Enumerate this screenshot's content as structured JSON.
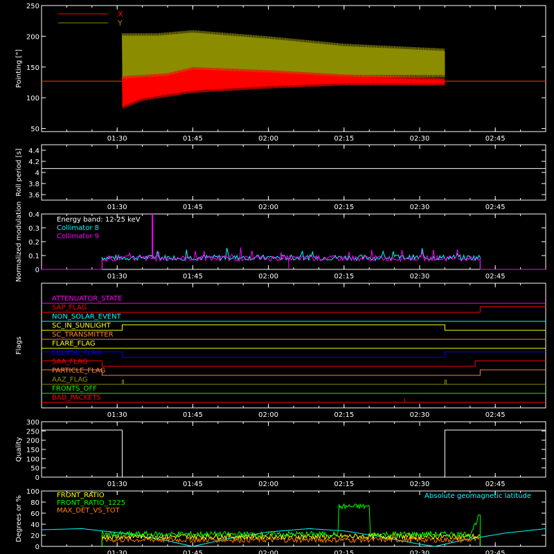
{
  "chart_data": [
    {
      "type": "line",
      "ylabel": "Pointing [\"]",
      "ylim": [
        45,
        250
      ],
      "yticks": [
        50,
        100,
        150,
        200,
        250
      ],
      "xlim": [
        "01:15",
        "02:55"
      ],
      "xticks": [
        "01:30",
        "01:45",
        "02:00",
        "02:15",
        "02:30",
        "02:45"
      ],
      "legend": [
        "X",
        "Y"
      ],
      "legend_colors": [
        "#ff0000",
        "#8c8c00"
      ],
      "series": [
        {
          "name": "Y",
          "color": "#8c8c00",
          "baseline": 127,
          "active_start": "01:31",
          "active_end": "02:35",
          "band_min": [
            [
              "01:31",
              100
            ],
            [
              "01:35",
              118
            ],
            [
              "01:45",
              128
            ],
            [
              "02:00",
              130
            ],
            [
              "02:15",
              133
            ],
            [
              "02:35",
              133
            ]
          ],
          "band_max": [
            [
              "01:31",
              205
            ],
            [
              "01:38",
              205
            ],
            [
              "01:45",
              210
            ],
            [
              "02:00",
              200
            ],
            [
              "02:15",
              188
            ],
            [
              "02:35",
              180
            ]
          ]
        },
        {
          "name": "X",
          "color": "#ff0000",
          "baseline": 127,
          "active_start": "01:31",
          "active_end": "02:35",
          "band_min": [
            [
              "01:31",
              82
            ],
            [
              "01:35",
              95
            ],
            [
              "01:45",
              108
            ],
            [
              "02:00",
              115
            ],
            [
              "02:15",
              120
            ],
            [
              "02:35",
              120
            ]
          ],
          "band_max": [
            [
              "01:31",
              135
            ],
            [
              "01:40",
              140
            ],
            [
              "01:45",
              150
            ],
            [
              "02:00",
              145
            ],
            [
              "02:15",
              138
            ],
            [
              "02:35",
              132
            ]
          ]
        }
      ]
    },
    {
      "type": "line",
      "ylabel": "Roll period [s]",
      "ylim": [
        3.5,
        4.5
      ],
      "yticks": [
        3.6,
        3.8,
        4.0,
        4.2,
        4.4
      ],
      "xticks": [
        "01:30",
        "01:45",
        "02:00",
        "02:15",
        "02:30",
        "02:45"
      ],
      "series": [
        {
          "name": "",
          "color": "#ffffff",
          "value": 4.07
        }
      ]
    },
    {
      "type": "line",
      "ylabel": "Normalized modulation",
      "ylim": [
        0.0,
        0.4
      ],
      "yticks": [
        0.0,
        0.1,
        0.2,
        0.3,
        0.4
      ],
      "xticks": [
        "01:30",
        "01:45",
        "02:00",
        "02:15",
        "02:30",
        "02:45"
      ],
      "annotation": "Energy band: 12-25 keV",
      "series": [
        {
          "name": "Collimator 8",
          "color": "#00ffff",
          "start": "01:27",
          "end": "02:42",
          "level": 0.085
        },
        {
          "name": "Collimator 9",
          "color": "#ff00ff",
          "start": "01:27",
          "end": "02:42",
          "level": 0.08,
          "spike_time": "01:37",
          "spike_value": 0.4,
          "dip_time": "02:04"
        }
      ]
    },
    {
      "type": "line",
      "ylabel": "Flags",
      "xticks": [
        "01:30",
        "01:45",
        "02:00",
        "02:15",
        "02:30",
        "02:45"
      ],
      "flags": [
        {
          "name": "ATTENUATOR_STATE",
          "color": "#ff00ff",
          "transitions": []
        },
        {
          "name": "SAP_FLAG",
          "color": "#ff0000",
          "transitions": [
            [
              "02:42",
              1
            ]
          ]
        },
        {
          "name": "NON_SOLAR_EVENT",
          "color": "#00ffff",
          "transitions": []
        },
        {
          "name": "SC_IN_SUNLIGHT",
          "color": "#ffff00",
          "transitions": [
            [
              "01:31",
              1
            ],
            [
              "02:35",
              0
            ]
          ]
        },
        {
          "name": "SC_TRANSMITTER",
          "color": "#ff8040",
          "transitions": []
        },
        {
          "name": "FLARE_FLAG",
          "color": "#ffff00",
          "transitions": []
        },
        {
          "name": "ECLIPSE_FLAG",
          "color": "#0000ff",
          "transitions": [
            [
              "01:31",
              0
            ],
            [
              "02:35",
              1
            ]
          ]
        },
        {
          "name": "SAA_FLAG",
          "color": "#ff0000",
          "transitions": [
            [
              "01:27",
              0
            ],
            [
              "02:41",
              1
            ]
          ]
        },
        {
          "name": "PARTICLE_FLAG",
          "color": "#ff8040",
          "transitions": [
            [
              "01:27",
              0
            ],
            [
              "02:42",
              1
            ]
          ]
        },
        {
          "name": "AAZ_FLAG",
          "color": "#8c8c00",
          "transitions": []
        },
        {
          "name": "FRONTS_OFF",
          "color": "#00ff00",
          "transitions": []
        },
        {
          "name": "BAD_PACKETS",
          "color": "#ff0000",
          "transitions": []
        }
      ]
    },
    {
      "type": "line",
      "ylabel": "Quality",
      "ylim": [
        0,
        300
      ],
      "yticks": [
        0,
        50,
        100,
        150,
        200,
        250,
        300
      ],
      "xticks": [
        "01:30",
        "01:45",
        "02:00",
        "02:15",
        "02:30",
        "02:45"
      ],
      "series": [
        {
          "name": "",
          "color": "#ffffff",
          "high": 255,
          "low": 0,
          "low_start": "01:31",
          "low_end": "02:35"
        }
      ]
    },
    {
      "type": "line",
      "ylabel": "Degrees or %",
      "ylim": [
        0,
        100
      ],
      "yticks": [
        0,
        20,
        40,
        60,
        80,
        100
      ],
      "xticks": [
        "01:30",
        "01:45",
        "02:00",
        "02:15",
        "02:30",
        "02:45"
      ],
      "legend": [
        "FRONT_RATIO",
        "FRONT_RATIO_1225",
        "MAX_DET_VS_TOT"
      ],
      "legend_colors": [
        "#ffff00",
        "#00ff00",
        "#ff8000"
      ],
      "annotation": "Absolute geomagnetic latitude",
      "annotation_color": "#00ffff",
      "series": [
        {
          "name": "FRONT_RATIO",
          "color": "#ffff00",
          "start": "01:27",
          "end": "02:42",
          "level": 18
        },
        {
          "name": "FRONT_RATIO_1225",
          "color": "#00ff00",
          "start": "01:27",
          "end": "02:42",
          "level": 22,
          "plateau_start": "02:14",
          "plateau_end": "02:20",
          "plateau_level": 72,
          "rise_end": 58
        },
        {
          "name": "MAX_DET_VS_TOT",
          "color": "#ff8000",
          "start": "01:27",
          "end": "02:42",
          "level": 12
        },
        {
          "name": "Absolute geomagnetic latitude",
          "color": "#00ffff",
          "points": [
            [
              "01:15",
              30
            ],
            [
              "01:23",
              32
            ],
            [
              "01:31",
              24
            ],
            [
              "01:39",
              12
            ],
            [
              "01:45",
              0
            ],
            [
              "01:52",
              14
            ],
            [
              "02:00",
              26
            ],
            [
              "02:08",
              32
            ],
            [
              "02:15",
              28
            ],
            [
              "02:22",
              18
            ],
            [
              "02:30",
              4
            ],
            [
              "02:33",
              0
            ],
            [
              "02:39",
              12
            ],
            [
              "02:47",
              24
            ],
            [
              "02:55",
              32
            ]
          ]
        }
      ]
    }
  ]
}
